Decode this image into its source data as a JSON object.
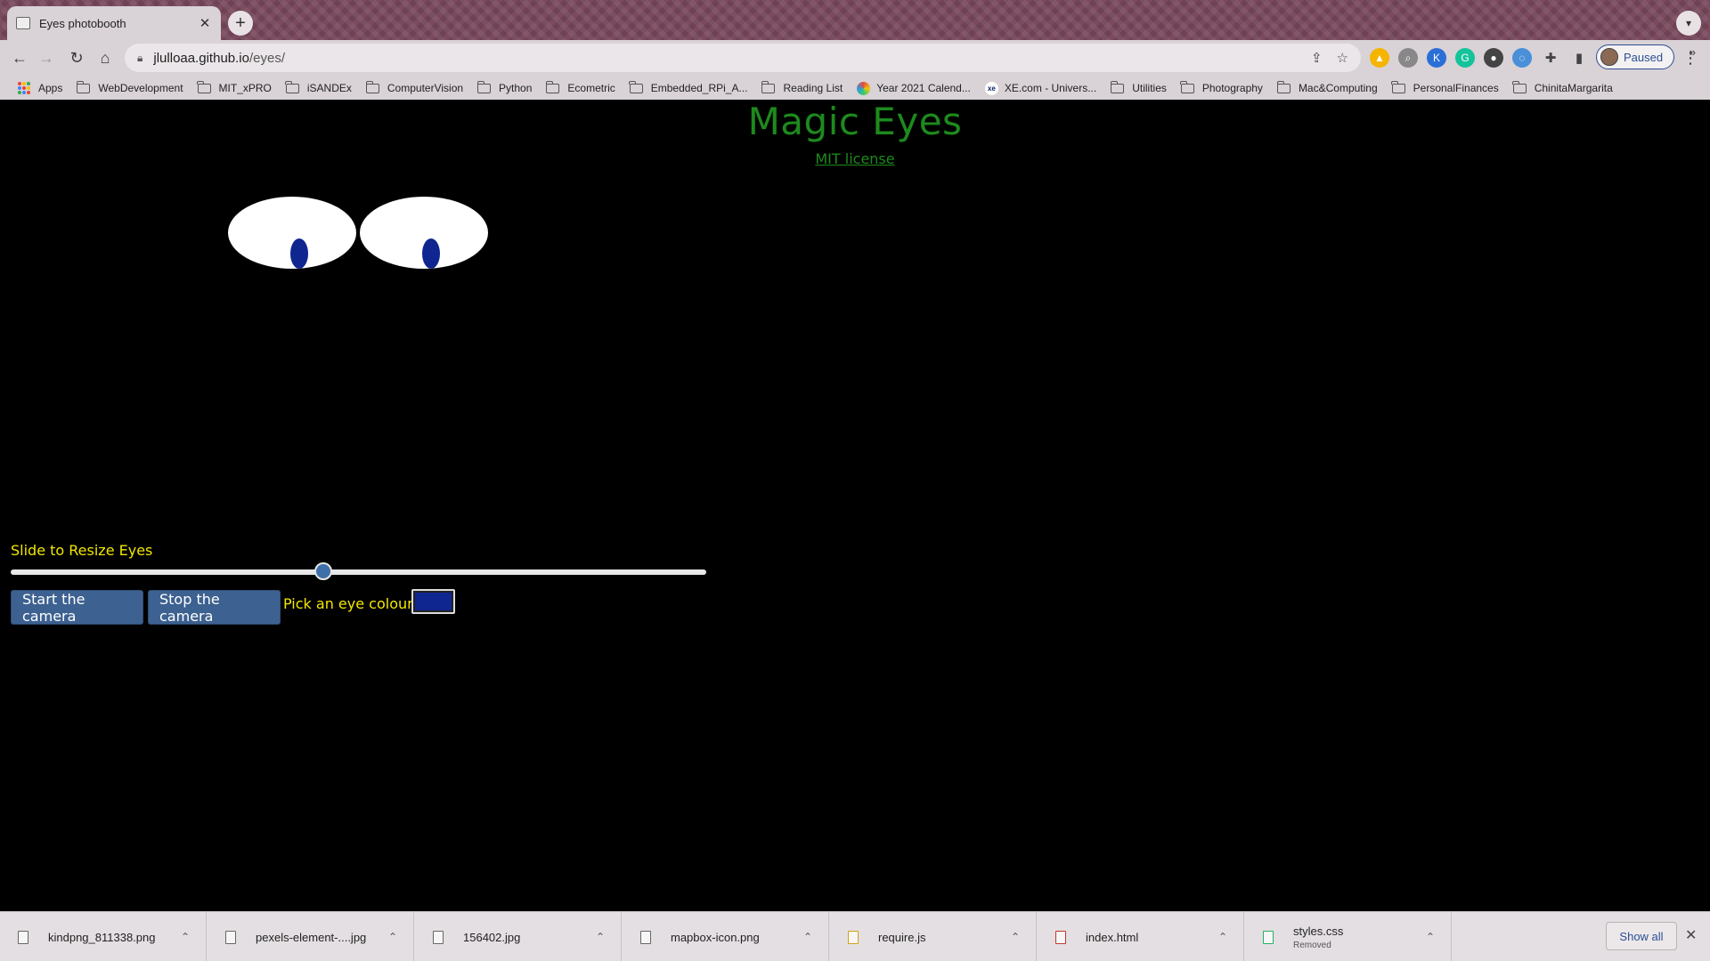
{
  "browser": {
    "tab_title": "Eyes photobooth",
    "tab_close": "✕",
    "new_tab": "+",
    "url_domain": "jlulloaa.github.io",
    "url_path": "/eyes/",
    "profile_label": "Paused",
    "bookmarks": [
      {
        "label": "Apps",
        "icon": "apps-grid-icon"
      },
      {
        "label": "WebDevelopment",
        "icon": "folder-icon"
      },
      {
        "label": "MIT_xPRO",
        "icon": "folder-icon"
      },
      {
        "label": "iSANDEx",
        "icon": "folder-icon"
      },
      {
        "label": "ComputerVision",
        "icon": "folder-icon"
      },
      {
        "label": "Python",
        "icon": "folder-icon"
      },
      {
        "label": "Ecometric",
        "icon": "folder-icon"
      },
      {
        "label": "Embedded_RPi_A...",
        "icon": "folder-icon"
      },
      {
        "label": "Reading List",
        "icon": "folder-icon"
      },
      {
        "label": "Year 2021 Calend...",
        "icon": "calendar-site-icon"
      },
      {
        "label": "XE.com - Univers...",
        "icon": "xe-site-icon"
      },
      {
        "label": "Utilities",
        "icon": "folder-icon"
      },
      {
        "label": "Photography",
        "icon": "folder-icon"
      },
      {
        "label": "Mac&Computing",
        "icon": "folder-icon"
      },
      {
        "label": "PersonalFinances",
        "icon": "folder-icon"
      },
      {
        "label": "ChinitaMargarita",
        "icon": "folder-icon"
      }
    ]
  },
  "page": {
    "title": "Magic Eyes",
    "license_link": "MIT license",
    "slider_label": "Slide to Resize Eyes",
    "slider_value": 0.45,
    "start_button": "Start the camera",
    "stop_button": "Stop the camera",
    "pick_label": "Pick an eye colour:",
    "eye_colour": "#0f2690"
  },
  "downloads": {
    "items": [
      {
        "name": "kindpng_811338.png",
        "sub": ""
      },
      {
        "name": "pexels-element-....jpg",
        "sub": ""
      },
      {
        "name": "156402.jpg",
        "sub": ""
      },
      {
        "name": "mapbox-icon.png",
        "sub": ""
      },
      {
        "name": "require.js",
        "sub": ""
      },
      {
        "name": "index.html",
        "sub": ""
      },
      {
        "name": "styles.css",
        "sub": "Removed"
      }
    ],
    "show_all": "Show all"
  },
  "colors": {
    "title_green": "#1d8a1d",
    "label_yellow": "#f2e600",
    "button_blue": "#3d6190"
  }
}
